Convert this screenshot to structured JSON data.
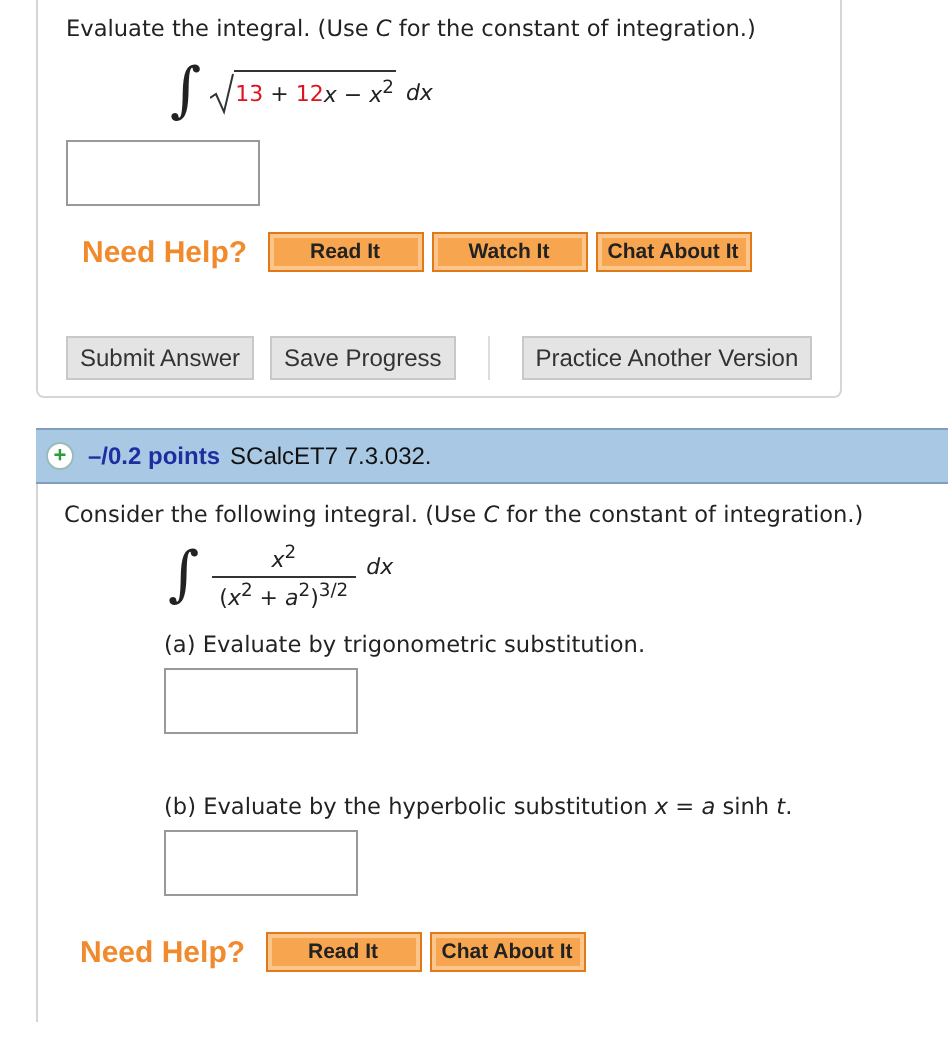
{
  "question_1": {
    "prompt": "Evaluate the integral. (Use *C* for the constant of integration.)",
    "integral_sign": "∫",
    "integrand": [
      {
        "text": "13",
        "kind": "param"
      },
      {
        "text": " + ",
        "kind": "plain"
      },
      {
        "text": "12",
        "kind": "param"
      },
      {
        "text": "*x* − *x*$^{2}$",
        "kind": "plain"
      }
    ],
    "differential": "*dx*",
    "help": {
      "label": "Need Help?",
      "buttons": [
        "Read It",
        "Watch It",
        "Chat About It"
      ]
    },
    "actions": {
      "main": [
        "Submit Answer",
        "Save Progress"
      ],
      "extra": [
        "Practice Another Version"
      ]
    }
  },
  "question_2": {
    "header": {
      "expand_icon": "+",
      "points": "–/0.2 points",
      "source": "SCalcET7 7.3.032."
    },
    "prompt": "Consider the following integral. (Use *C* for the constant of integration.)",
    "integral_sign": "∫",
    "numerator": "*x*$^{2}$",
    "denominator": "(*x*$^{2}$ + *a*$^{2}$)$^{3/2}$",
    "differential": "*dx*",
    "parts": [
      {
        "label": "(a) Evaluate by trigonometric substitution."
      },
      {
        "label": "(b) Evaluate by the hyperbolic substitution  *x* = *a* sinh *t*."
      }
    ],
    "help": {
      "label": "Need Help?",
      "buttons": [
        "Read It",
        "Chat About It"
      ]
    }
  }
}
